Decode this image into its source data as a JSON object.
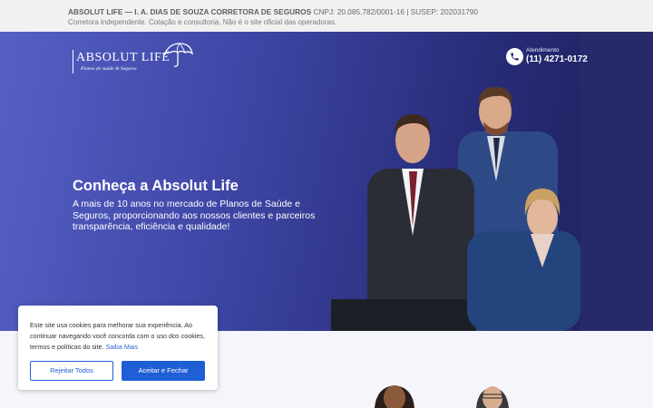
{
  "topbar": {
    "company": "ABSOLUT LIFE — I. A. DIAS DE SOUZA CORRETORA DE SEGUROS",
    "registration": "CNPJ: 20.085.782/0001-16 | SUSEP: 202031790",
    "disclaimer": "Corretora independente. Cotação e consultoria. Não é o site oficial das operadoras."
  },
  "header": {
    "logo_name": "ABSOLUT LIFE",
    "logo_tagline": "Planos de saúde & Seguros",
    "contact_label": "Atendimento",
    "contact_phone": "(11) 4271-0172"
  },
  "hero": {
    "title": "Conheça a Absolut Life",
    "description": "A mais de 10 anos no mercado de Planos de Saúde e Seguros, proporcionando aos nossos clientes e parceiros transparência, eficiência e qualidade!"
  },
  "cookie_banner": {
    "message": "Este site usa cookies para melhorar sua experiência. Ao continuar navegando você concorda com o uso dos cookies, termos e políticas do site.",
    "link_label": "Saiba Mais",
    "reject_label": "Rejeitar Todos",
    "accept_label": "Aceitar e Fechar"
  },
  "colors": {
    "hero_start": "#5660c5",
    "hero_end": "#1c2057",
    "accent_blue": "#1f5fd6"
  },
  "icons": {
    "logo": "umbrella-icon",
    "contact": "phone-icon"
  }
}
